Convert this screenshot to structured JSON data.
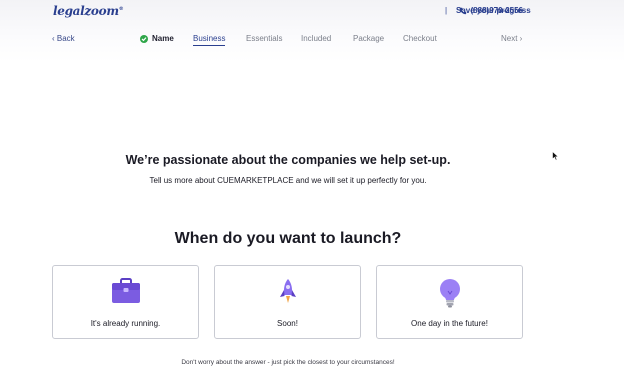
{
  "header": {
    "logo_text": "legalzoom",
    "logo_mark": "®",
    "phone": "(888)970-2556",
    "separator": "|",
    "save_progress": "Save your progress"
  },
  "nav": {
    "back": "‹ Back",
    "steps": [
      "Name",
      "Business",
      "Essentials",
      "Included",
      "Package",
      "Checkout"
    ],
    "completed_step": "Name",
    "active_step": "Business",
    "next": "Next ›"
  },
  "main": {
    "headline": "We’re passionate about the companies we help set-up.",
    "subtext": "Tell us more about CUEMARKETPLACE and we will set it up perfectly for you.",
    "question": "When do you want to launch?",
    "options": [
      {
        "label": "It's already running.",
        "icon": "briefcase-icon"
      },
      {
        "label": "Soon!",
        "icon": "rocket-icon"
      },
      {
        "label": "One day in the future!",
        "icon": "lightbulb-icon"
      }
    ],
    "footnote": "Don't worry about the answer - just pick the closest to your circumstances!"
  },
  "colors": {
    "brand": "#2a3f8f",
    "accent": "#7b5ce1",
    "check": "#2fa64a"
  }
}
